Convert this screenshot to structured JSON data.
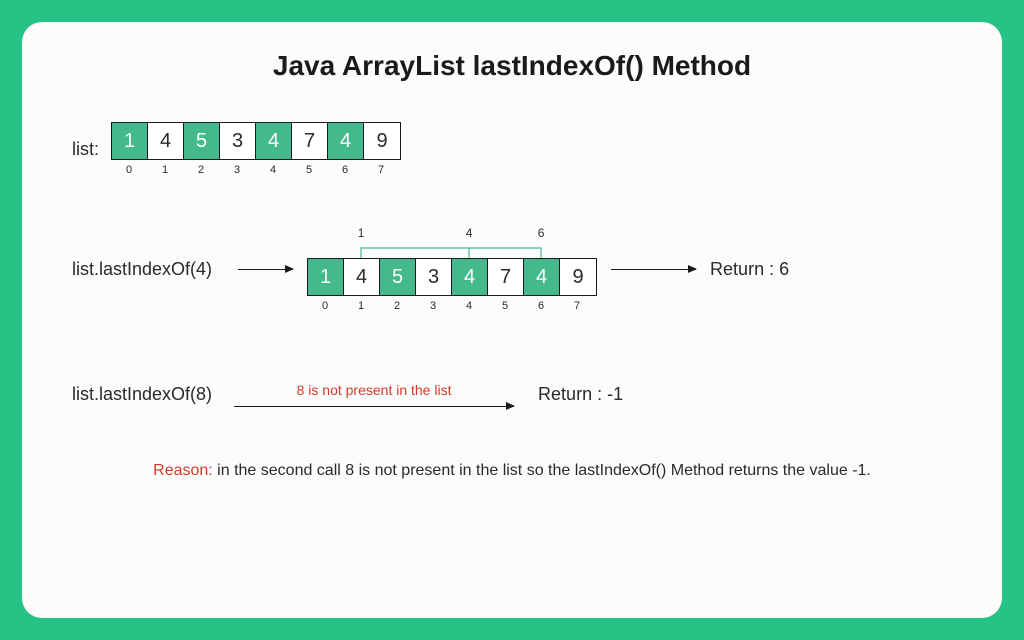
{
  "title": "Java ArrayList lastIndexOf() Method",
  "list_label": "list:",
  "array": {
    "cells": [
      "1",
      "4",
      "5",
      "3",
      "4",
      "7",
      "4",
      "9"
    ],
    "green_positions": [
      0,
      2,
      4,
      6
    ],
    "indices": [
      "0",
      "1",
      "2",
      "3",
      "4",
      "5",
      "6",
      "7"
    ]
  },
  "example1": {
    "call": "list.lastIndexOf(4)",
    "top_marks": {
      "1": "1",
      "4": "4",
      "6": "6"
    },
    "return": "Return : 6"
  },
  "example2": {
    "call": "list.lastIndexOf(8)",
    "note": "8 is not present in the list",
    "return": "Return : -1"
  },
  "reason": {
    "label": "Reason:",
    "text": " in the second call 8 is not present in the list so the lastIndexOf() Method returns the value -1."
  },
  "chart_data": {
    "type": "table",
    "title": "Java ArrayList lastIndexOf() Method",
    "list_values": [
      1,
      4,
      5,
      3,
      4,
      7,
      4,
      9
    ],
    "list_indices": [
      0,
      1,
      2,
      3,
      4,
      5,
      6,
      7
    ],
    "highlighted_indices": [
      0,
      2,
      4,
      6
    ],
    "calls": [
      {
        "method": "list.lastIndexOf(4)",
        "occurrence_indices": [
          1,
          4,
          6
        ],
        "returns": 6
      },
      {
        "method": "list.lastIndexOf(8)",
        "occurrence_indices": [],
        "returns": -1,
        "note": "8 is not present in the list"
      }
    ],
    "reason": "in the second call 8 is not present in the list so the lastIndexOf() Method returns the value -1."
  }
}
